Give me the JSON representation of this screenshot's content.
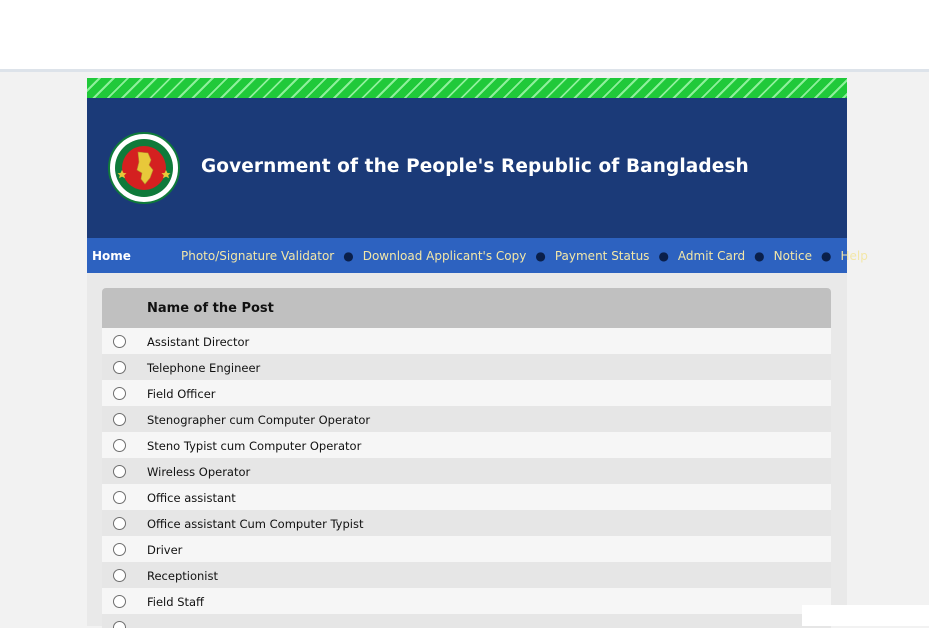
{
  "header": {
    "title": "Government of the People's Republic of Bangladesh",
    "logo_icon": "bangladesh-government-seal",
    "colors": {
      "banner": "#1b3a78",
      "stripe": "#20c93a",
      "nav": "#2d62c0",
      "seal_red": "#d42020",
      "seal_green": "#0f7a3a"
    }
  },
  "nav": {
    "home": "Home",
    "links": [
      "Photo/Signature Validator",
      "Download Applicant's Copy",
      "Payment Status",
      "Admit Card",
      "Notice",
      "Help"
    ]
  },
  "posts": {
    "header": "Name of the Post",
    "items": [
      "Assistant Director",
      "Telephone Engineer",
      "Field Officer",
      "Stenographer cum Computer Operator",
      "Steno Typist cum Computer Operator",
      "Wireless Operator",
      "Office assistant",
      "Office assistant Cum Computer Typist",
      "Driver",
      "Receptionist",
      "Field Staff",
      ""
    ]
  }
}
